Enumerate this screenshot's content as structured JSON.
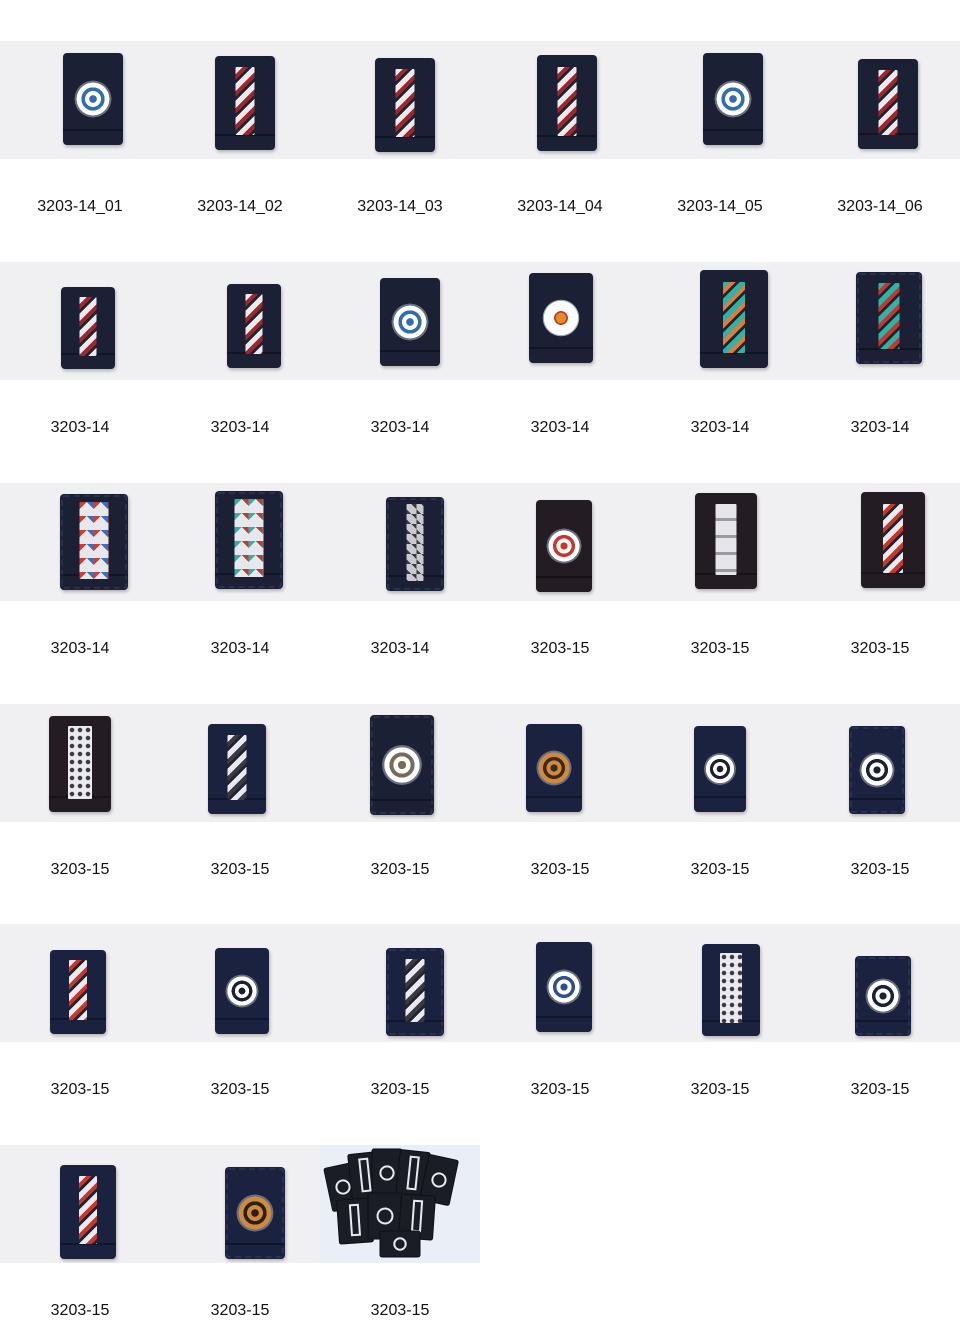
{
  "catalog": {
    "items": [
      {
        "code": "3203-14_01",
        "motif": "rosette",
        "colors": [
          "#ffffff",
          "#2f6fb0"
        ]
      },
      {
        "code": "3203-14_02",
        "motif": "stripe",
        "colors": [
          "#e9e9ee",
          "#a0262b"
        ]
      },
      {
        "code": "3203-14_03",
        "motif": "stripe",
        "colors": [
          "#e9e9ee",
          "#a0262b"
        ]
      },
      {
        "code": "3203-14_04",
        "motif": "stripe",
        "colors": [
          "#e9e9ee",
          "#a0262b"
        ]
      },
      {
        "code": "3203-14_05",
        "motif": "rosette",
        "colors": [
          "#ffffff",
          "#2f6fb0"
        ]
      },
      {
        "code": "3203-14_06",
        "motif": "stripe",
        "colors": [
          "#e9e9ee",
          "#a0262b"
        ]
      },
      {
        "code": "3203-14",
        "motif": "stripe",
        "colors": [
          "#e9e9ee",
          "#a0262b"
        ]
      },
      {
        "code": "3203-14",
        "motif": "stripe",
        "colors": [
          "#e9e9ee",
          "#a0262b"
        ]
      },
      {
        "code": "3203-14",
        "motif": "rosette",
        "colors": [
          "#ffffff",
          "#2f6fb0"
        ]
      },
      {
        "code": "3203-14",
        "motif": "flower",
        "colors": [
          "#ffffff",
          "#e38b2c"
        ]
      },
      {
        "code": "3203-14",
        "motif": "stripe",
        "colors": [
          "#2fb3a8",
          "#e07b3a"
        ]
      },
      {
        "code": "3203-14",
        "motif": "stripe",
        "colors": [
          "#2fb3a8",
          "#c8372d"
        ]
      },
      {
        "code": "3203-14",
        "motif": "triangles",
        "colors": [
          "#d63b2f",
          "#2f73c8"
        ]
      },
      {
        "code": "3203-14",
        "motif": "triangles",
        "colors": [
          "#2fb3a8",
          "#c8372d"
        ]
      },
      {
        "code": "3203-14",
        "motif": "diamonds",
        "colors": [
          "#c9c9cf",
          "#3a3a44"
        ]
      },
      {
        "code": "3203-15",
        "motif": "rosette",
        "colors": [
          "#ffffff",
          "#c8372d"
        ]
      },
      {
        "code": "3203-15",
        "motif": "blocks",
        "colors": [
          "#e6e6ea",
          "#9a9aa2"
        ]
      },
      {
        "code": "3203-15",
        "motif": "stripe",
        "colors": [
          "#e9e9ee",
          "#c8372d"
        ]
      },
      {
        "code": "3203-15",
        "motif": "dots",
        "colors": [
          "#e9e9ee",
          "#3a3a44"
        ]
      },
      {
        "code": "3203-15",
        "motif": "stripe",
        "colors": [
          "#e9e9ee",
          "#3a3a44"
        ]
      },
      {
        "code": "3203-15",
        "motif": "rosette",
        "colors": [
          "#ffffff",
          "#7a6a5a"
        ]
      },
      {
        "code": "3203-15",
        "motif": "rosette",
        "colors": [
          "#d08a3c",
          "#3a2a20"
        ]
      },
      {
        "code": "3203-15",
        "motif": "rosette",
        "colors": [
          "#ffffff",
          "#1b2035"
        ]
      },
      {
        "code": "3203-15",
        "motif": "rosette",
        "colors": [
          "#ffffff",
          "#1b2035"
        ]
      },
      {
        "code": "3203-15",
        "motif": "stripe",
        "colors": [
          "#e9e9ee",
          "#c8372d"
        ]
      },
      {
        "code": "3203-15",
        "motif": "rosette",
        "colors": [
          "#ffffff",
          "#1b2035"
        ]
      },
      {
        "code": "3203-15",
        "motif": "stripe",
        "colors": [
          "#e9e9ee",
          "#3a3a44"
        ]
      },
      {
        "code": "3203-15",
        "motif": "rosette",
        "colors": [
          "#ffffff",
          "#2f4f8f"
        ]
      },
      {
        "code": "3203-15",
        "motif": "dots",
        "colors": [
          "#e9e9ee",
          "#3a3a44"
        ]
      },
      {
        "code": "3203-15",
        "motif": "rosette",
        "colors": [
          "#ffffff",
          "#1b2035"
        ]
      },
      {
        "code": "3203-15",
        "motif": "stripe",
        "colors": [
          "#e9e9ee",
          "#c8372d"
        ]
      },
      {
        "code": "3203-15",
        "motif": "rosette",
        "colors": [
          "#d08a3c",
          "#2a2018"
        ]
      },
      {
        "code": "3203-15",
        "motif": "group",
        "colors": [
          "#1b1d26",
          "#e9e9ee"
        ]
      }
    ]
  }
}
